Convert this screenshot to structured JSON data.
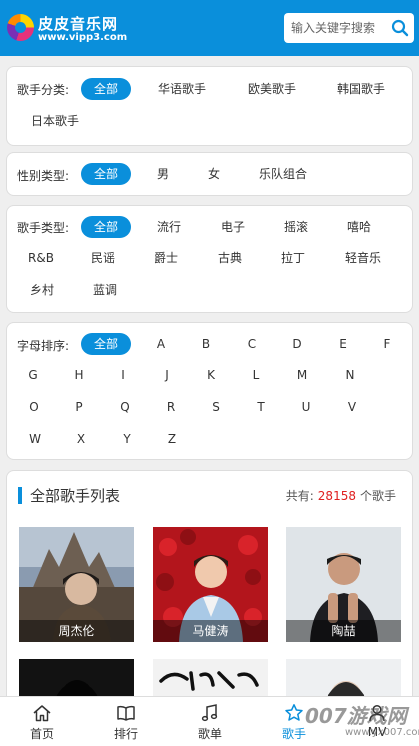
{
  "header": {
    "site_name": "皮皮音乐网",
    "site_url": "www.vipp3.com",
    "brand_color": "#0a8fdb"
  },
  "search": {
    "placeholder": "输入关键字搜索"
  },
  "filters": {
    "category": {
      "label": "歌手分类:",
      "options": [
        "全部",
        "华语歌手",
        "欧美歌手",
        "韩国歌手",
        "日本歌手"
      ],
      "selected": "全部"
    },
    "gender": {
      "label": "性别类型:",
      "options": [
        "全部",
        "男",
        "女",
        "乐队组合"
      ],
      "selected": "全部"
    },
    "genre": {
      "label": "歌手类型:",
      "options": [
        "全部",
        "流行",
        "电子",
        "摇滚",
        "嘻哈",
        "R&B",
        "民谣",
        "爵士",
        "古典",
        "拉丁",
        "轻音乐",
        "乡村",
        "蓝调"
      ],
      "selected": "全部"
    },
    "letter": {
      "label": "字母排序:",
      "options": [
        "全部",
        "A",
        "B",
        "C",
        "D",
        "E",
        "F",
        "G",
        "H",
        "I",
        "J",
        "K",
        "L",
        "M",
        "N",
        "O",
        "P",
        "Q",
        "R",
        "S",
        "T",
        "U",
        "V",
        "W",
        "X",
        "Y",
        "Z"
      ],
      "selected": "全部"
    }
  },
  "artist_list": {
    "title": "全部歌手列表",
    "count_prefix": "共有:",
    "count": "28158",
    "count_suffix": "个歌手",
    "count_color": "#e02020",
    "artists": [
      {
        "name": "周杰伦"
      },
      {
        "name": "马健涛"
      },
      {
        "name": "陶喆"
      },
      {
        "name": ""
      },
      {
        "name": ""
      },
      {
        "name": ""
      }
    ]
  },
  "tabbar": {
    "items": [
      {
        "label": "首页",
        "icon": "home-icon"
      },
      {
        "label": "排行",
        "icon": "book-icon"
      },
      {
        "label": "歌单",
        "icon": "music-note-icon"
      },
      {
        "label": "歌手",
        "icon": "star-icon",
        "active": true
      },
      {
        "label": "MV",
        "icon": "user-icon"
      }
    ]
  },
  "watermark": {
    "text": "007游戏网",
    "url": "www.yx007.com"
  }
}
